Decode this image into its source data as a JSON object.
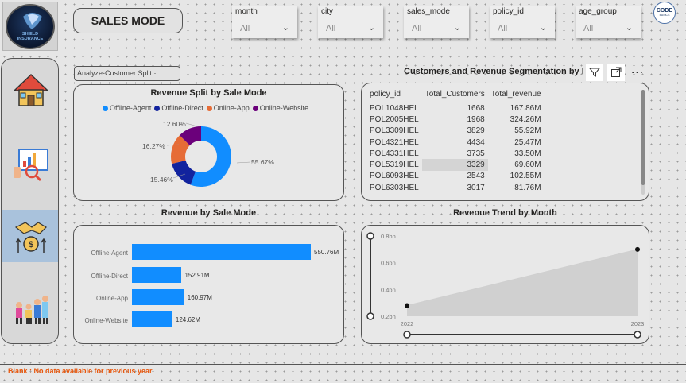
{
  "logo": {
    "text_line1": "SHIELD",
    "text_line2": "INSURANCE"
  },
  "page_title": "SALES MODE",
  "slicers": [
    {
      "label": "month",
      "value": "All"
    },
    {
      "label": "city",
      "value": "All"
    },
    {
      "label": "sales_mode",
      "value": "All"
    },
    {
      "label": "policy_id",
      "value": "All"
    },
    {
      "label": "age_group",
      "value": "All"
    }
  ],
  "codebasics": {
    "line1": "CODE",
    "line2": "BASICS"
  },
  "analyze_button": "Analyze-Customer Split ·",
  "nav": [
    {
      "name": "home",
      "icon": "home-icon"
    },
    {
      "name": "analytics",
      "icon": "analytics-icon"
    },
    {
      "name": "sales",
      "icon": "money-handshake-icon",
      "active": true
    },
    {
      "name": "customers",
      "icon": "family-icon"
    }
  ],
  "donut": {
    "title": "Revenue Split by Sale Mode",
    "legend": [
      "Offline-Agent",
      "Offline-Direct",
      "Online-App",
      "Online-Website"
    ],
    "colors": [
      "#118dff",
      "#12239e",
      "#e66c37",
      "#6b007b"
    ],
    "labels": [
      "55.67%",
      "15.46%",
      "16.27%",
      "12.60%"
    ]
  },
  "table": {
    "title": "Customers and Revenue Segmentation by Policy ID",
    "columns": [
      "policy_id",
      "Total_Customers",
      "Total_revenue"
    ],
    "rows": [
      [
        "POL1048HEL",
        "1668",
        "167.86M"
      ],
      [
        "POL2005HEL",
        "1968",
        "324.26M"
      ],
      [
        "POL3309HEL",
        "3829",
        "55.92M"
      ],
      [
        "POL4321HEL",
        "4434",
        "25.47M"
      ],
      [
        "POL4331HEL",
        "3735",
        "33.50M"
      ],
      [
        "POL5319HEL",
        "3329",
        "69.60M"
      ],
      [
        "POL6093HEL",
        "2543",
        "102.55M"
      ],
      [
        "POL6303HEL",
        "3017",
        "81.76M"
      ]
    ]
  },
  "bar_chart": {
    "title": "Revenue by Sale Mode",
    "categories": [
      "Offline-Agent",
      "Offline-Direct",
      "Online-App",
      "Online-Website"
    ],
    "values": [
      550.76,
      152.91,
      160.97,
      124.62
    ],
    "value_labels": [
      "550.76M",
      "152.91M",
      "160.97M",
      "124.62M"
    ],
    "color": "#118dff"
  },
  "chart_data": [
    {
      "type": "pie",
      "title": "Revenue Split by Sale Mode",
      "categories": [
        "Offline-Agent",
        "Offline-Direct",
        "Online-App",
        "Online-Website"
      ],
      "values": [
        55.67,
        15.46,
        16.27,
        12.6
      ]
    },
    {
      "type": "bar",
      "title": "Revenue by Sale Mode",
      "categories": [
        "Offline-Agent",
        "Offline-Direct",
        "Online-App",
        "Online-Website"
      ],
      "values": [
        550.76,
        152.91,
        160.97,
        124.62
      ]
    },
    {
      "type": "area",
      "title": "Revenue Trend by Month",
      "x": [
        "2022",
        "2023"
      ],
      "values": [
        0.28,
        0.7
      ],
      "ylim": [
        0.2,
        0.8
      ],
      "yticks": [
        "0.8bn",
        "0.6bn",
        "0.4bn",
        "0.2bn"
      ]
    }
  ],
  "trend": {
    "title": "Revenue Trend by Month",
    "yticks": [
      "0.8bn",
      "0.6bn",
      "0.4bn",
      "0.2bn"
    ],
    "xticks": [
      "2022",
      "2023"
    ]
  },
  "footer": "Blank : No data available for previous year"
}
